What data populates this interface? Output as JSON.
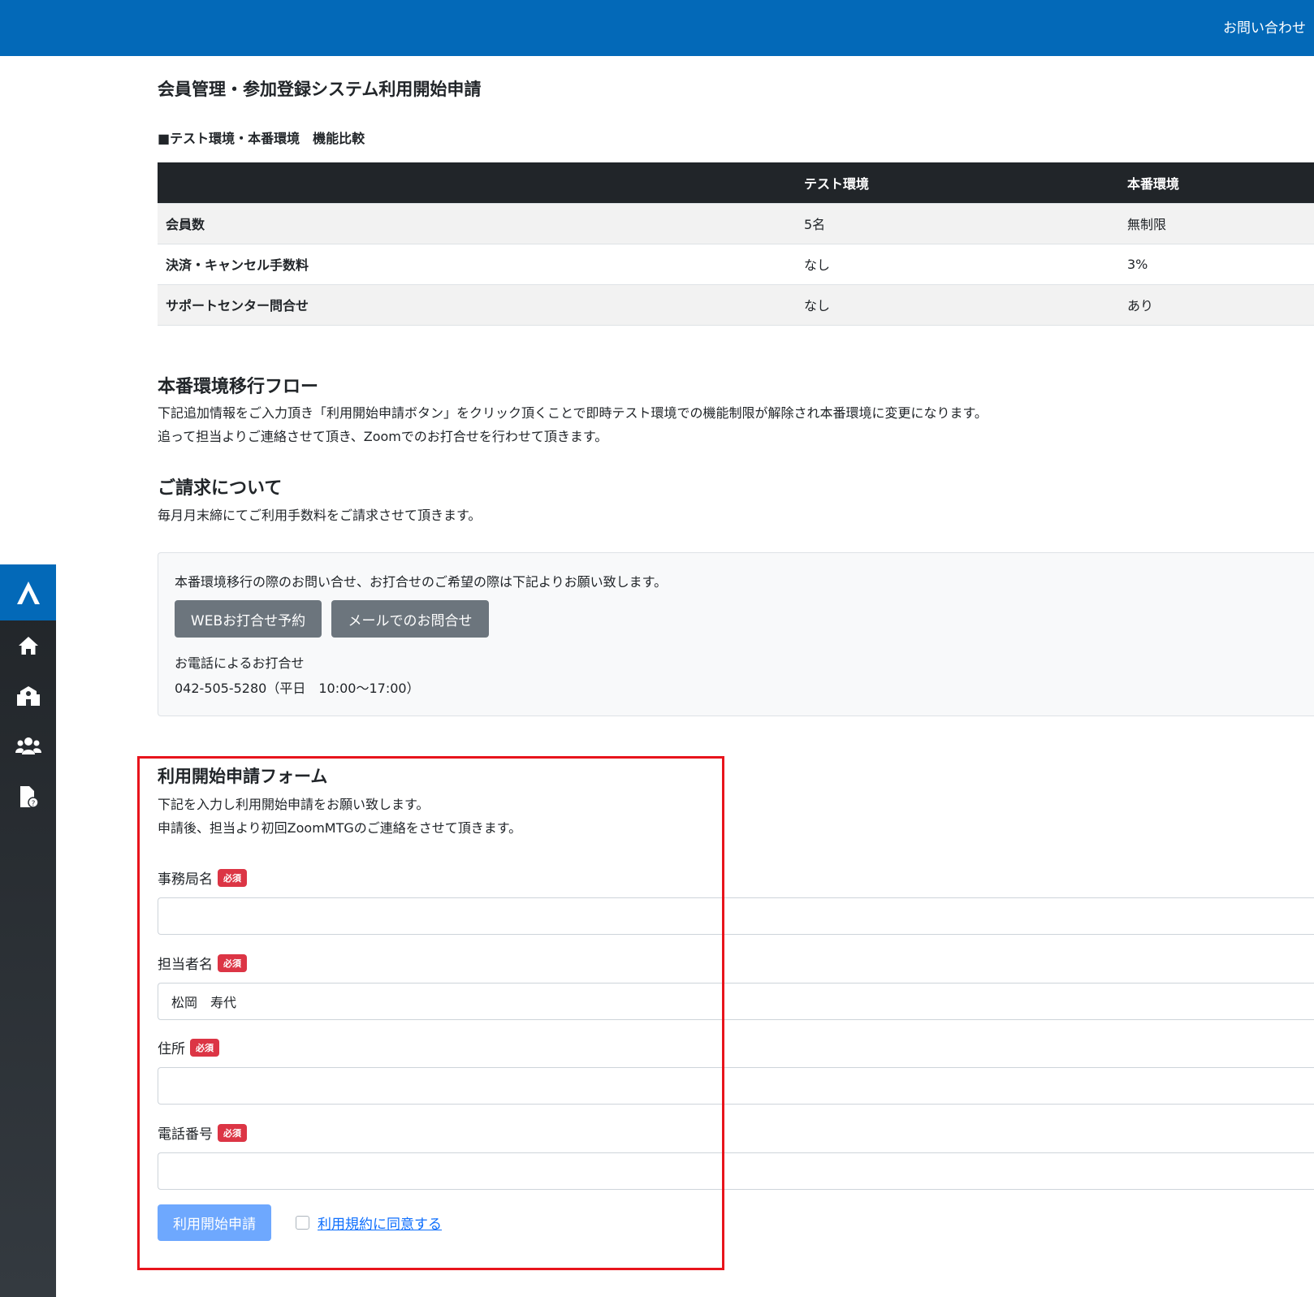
{
  "header": {
    "contact_link": "お問い合わせ"
  },
  "sidebar": {
    "logo_icon": "logo-icon",
    "items": [
      {
        "icon": "home-icon"
      },
      {
        "icon": "school-icon"
      },
      {
        "icon": "users-icon"
      },
      {
        "icon": "file-question-icon"
      }
    ]
  },
  "page": {
    "title": "会員管理・参加登録システム利用開始申請"
  },
  "comparison": {
    "heading": "■テスト環境・本番環境　機能比較",
    "columns": [
      "",
      "テスト環境",
      "本番環境"
    ],
    "rows": [
      [
        "会員数",
        "5名",
        "無制限"
      ],
      [
        "決済・キャンセル手数料",
        "なし",
        "3%"
      ],
      [
        "サポートセンター問合せ",
        "なし",
        "あり"
      ]
    ]
  },
  "flow": {
    "title": "本番環境移行フロー",
    "line1": "下記追加情報をご入力頂き「利用開始申請ボタン」をクリック頂くことで即時テスト環境での機能制限が解除され本番環境に変更になります。",
    "line2": "追って担当よりご連絡させて頂き、Zoomでのお打合せを行わせて頂きます。"
  },
  "billing": {
    "title": "ご請求について",
    "text": "毎月月末締にてご利用手数料をご請求させて頂きます。"
  },
  "contact": {
    "intro": "本番環境移行の際のお問い合せ、お打合せのご希望の際は下記よりお願い致します。",
    "web_button": "WEBお打合せ予約",
    "mail_button": "メールでのお問合せ",
    "phone_label": "お電話によるお打合せ",
    "phone_number": "042-505-5280（平日　10:00～17:00）"
  },
  "form": {
    "title": "利用開始申請フォーム",
    "desc1": "下記を入力し利用開始申請をお願い致します。",
    "desc2": "申請後、担当より初回ZoomMTGのご連絡をさせて頂きます。",
    "required_badge": "必須",
    "fields": [
      {
        "label": "事務局名",
        "value": ""
      },
      {
        "label": "担当者名",
        "value": "松岡　寿代"
      },
      {
        "label": "住所",
        "value": ""
      },
      {
        "label": "電話番号",
        "value": ""
      }
    ],
    "submit_label": "利用開始申請",
    "agree_checked": false,
    "agree_label": "利用規約に同意する"
  },
  "colors": {
    "brand": "#0369b8",
    "required": "#dc3545",
    "submit": "#6ea8fe",
    "highlight": "#e8141c"
  }
}
